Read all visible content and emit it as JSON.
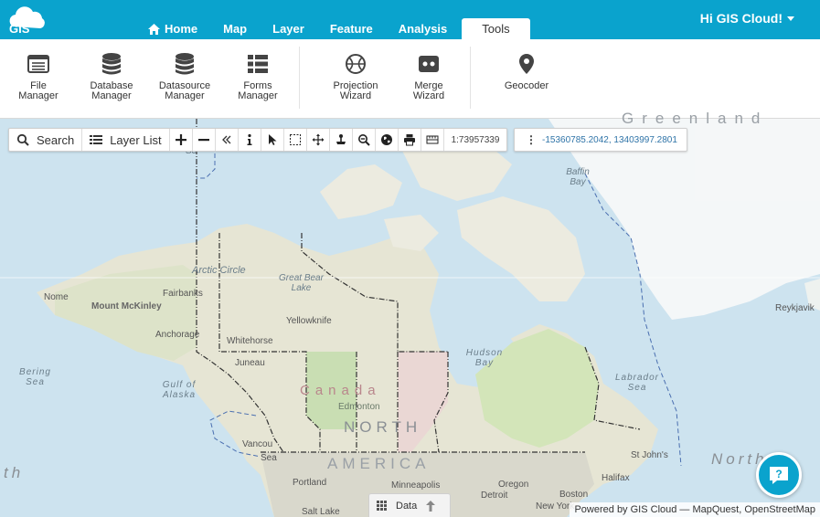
{
  "app": {
    "logo_text": "GIS",
    "user_greeting": "Hi GIS Cloud!"
  },
  "nav": {
    "tabs": [
      {
        "label": "Home",
        "icon": "home-icon"
      },
      {
        "label": "Map"
      },
      {
        "label": "Layer"
      },
      {
        "label": "Feature"
      },
      {
        "label": "Analysis"
      },
      {
        "label": "Tools",
        "active": true
      }
    ]
  },
  "ribbon": {
    "tools": [
      {
        "label": "File Manager",
        "icon": "file-manager-icon"
      },
      {
        "label": "Database Manager",
        "icon": "database-icon"
      },
      {
        "label": "Datasource Manager",
        "icon": "datasource-icon"
      },
      {
        "label": "Forms Manager",
        "icon": "forms-icon"
      },
      {
        "label": "Projection Wizard",
        "icon": "globe-icon"
      },
      {
        "label": "Merge Wizard",
        "icon": "merge-icon"
      },
      {
        "label": "Geocoder",
        "icon": "map-pin-icon"
      }
    ]
  },
  "map_toolbar": {
    "search_label": "Search",
    "layer_list_label": "Layer List",
    "scale": "1:73957339",
    "coordinates": "-15360785.2042, 13403997.2801",
    "tools": [
      "zoom-in-icon",
      "zoom-out-icon",
      "collapse-icon",
      "info-icon",
      "select-pointer-icon",
      "box-select-icon",
      "pan-icon",
      "anchor-icon",
      "zoom-box-icon",
      "globe-icon",
      "print-icon",
      "measure-icon"
    ]
  },
  "map": {
    "labels": {
      "arctic_circle": "Arctic Circle",
      "great_bear_lake": "Great Bear Lake",
      "nome": "Nome",
      "mount_mckinley": "Mount McKinley",
      "fairbanks": "Fairbanks",
      "anchorage": "Anchorage",
      "yellowknife": "Yellowknife",
      "whitehorse": "Whitehorse",
      "juneau": "Juneau",
      "bering_sea": "Bering Sea",
      "gulf_of_alaska": "Gulf of Alaska",
      "canada": "Canada",
      "edmonton": "Edmonton",
      "north": "NORTH",
      "america": "AMERICA",
      "vancouver": "Vancou",
      "seattle": "Sea",
      "portland": "Portland",
      "minneapolis": "Minneapolis",
      "detroit": "Detroit",
      "oregon": "Oregon",
      "halifax": "Halifax",
      "boston": "Boston",
      "new_york": "New York",
      "st_johns": "St John's",
      "salt_lake": "Salt Lake",
      "hudson_bay": "Hudson Bay",
      "baffin_bay": "Baffin Bay",
      "labrador_sea": "Labrador Sea",
      "greenland": "Greenland",
      "reykjavik": "Reykjavik",
      "north_atlantic": "North",
      "pacific_fragment": "th",
      "sea_fragment": "Se"
    }
  },
  "bottom": {
    "data_tab_label": "Data",
    "attribution": "Powered by GIS Cloud — MapQuest, OpenStreetMap"
  }
}
